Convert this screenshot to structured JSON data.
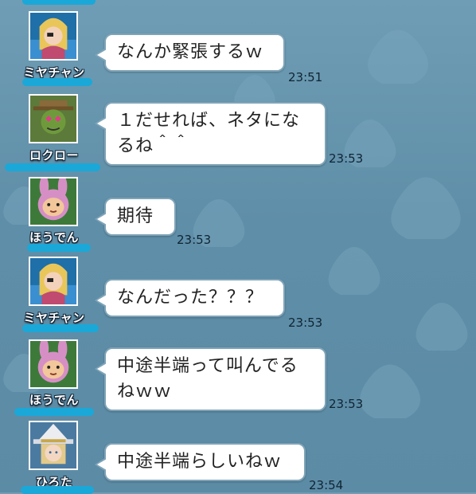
{
  "colors": {
    "background": "#6596af",
    "bubble": "#ffffff",
    "bubble_border": "#7fa4b8",
    "name_underline": "#1aa8d8",
    "timestamp_text": "#0f2533"
  },
  "messages": [
    {
      "sender": "ミヤチャン",
      "avatar": "blonde-eyepatch-avatar-icon",
      "lines": [
        "なんか緊張するｗ"
      ],
      "time": "23:51"
    },
    {
      "sender": "ロクロー",
      "avatar": "green-goblin-hat-avatar-icon",
      "lines": [
        "１だせれば、ネタにな",
        "るね＾＾"
      ],
      "time": "23:53"
    },
    {
      "sender": "ほうでん",
      "avatar": "pink-rabbit-hood-avatar-icon",
      "lines": [
        "期待"
      ],
      "time": "23:53"
    },
    {
      "sender": "ミヤチャン",
      "avatar": "blonde-eyepatch-avatar-icon",
      "lines": [
        "なんだった？？？"
      ],
      "time": "23:53"
    },
    {
      "sender": "ほうでん",
      "avatar": "pink-rabbit-hood-avatar-icon",
      "lines": [
        "中途半端って叫んでる",
        "ねｗｗ"
      ],
      "time": "23:53"
    },
    {
      "sender": "ひろた",
      "avatar": "white-witch-hat-avatar-icon",
      "lines": [
        "中途半端らしいねｗ"
      ],
      "time": "23:54"
    }
  ]
}
